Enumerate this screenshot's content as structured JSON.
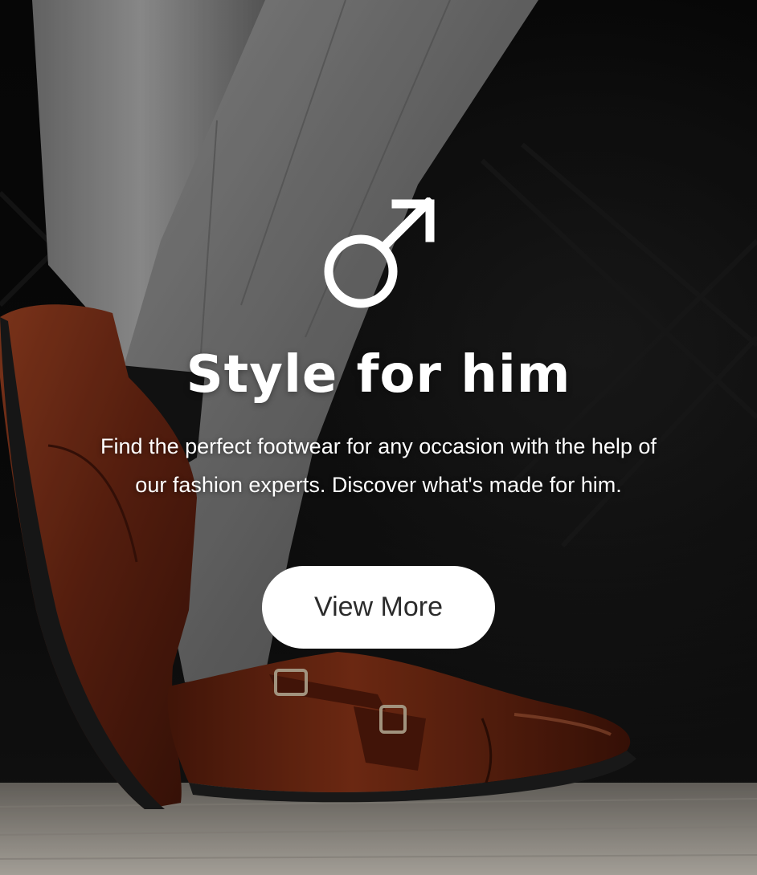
{
  "hero": {
    "title": "Style for him",
    "description": "Find the perfect footwear for any occasion with the help of our fashion experts. Discover what's made for him.",
    "cta_label": "View More",
    "symbol_icon": "male-symbol-icon",
    "background_image": "mens-trousers-and-brown-monk-strap-shoes-photo"
  },
  "colors": {
    "text": "#ffffff",
    "button_bg": "#ffffff",
    "button_text": "#2b2b2b",
    "shoe_brown": "#6b2814",
    "trouser_gray": "#8a8a8a"
  }
}
